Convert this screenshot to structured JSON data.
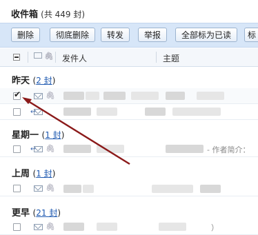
{
  "folder": {
    "title": "收件箱",
    "count_text": "(共 449 封)"
  },
  "toolbar": {
    "buttons": [
      "删除",
      "彻底删除",
      "转发",
      "举报",
      "全部标为已读",
      "标"
    ]
  },
  "list_header": {
    "sender": "发件人",
    "subject": "主题"
  },
  "groups": [
    {
      "name": "昨天",
      "link": "2 封",
      "rows": 2,
      "first_checked": true
    },
    {
      "name": "星期一",
      "link": "1 封",
      "rows": 1,
      "first_checked": false
    },
    {
      "name": "上周",
      "link": "1 封",
      "rows": 1,
      "first_checked": false
    },
    {
      "name": "更早",
      "link": "21 封",
      "rows": 1,
      "first_checked": false
    }
  ],
  "subject_snippet": "- 作者简介：",
  "trail_mark": "）",
  "colors": {
    "toolbar_bg": "#d7e6f8",
    "link": "#1d58b0",
    "annotation_arrow": "#8b1a1a"
  },
  "icons": [
    "envelope-icon",
    "paperclip-icon",
    "reply-envelope-icon",
    "checkbox-icon"
  ]
}
